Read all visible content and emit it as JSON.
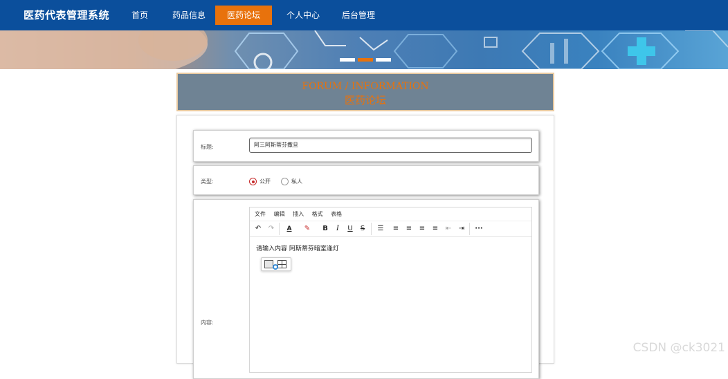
{
  "nav": {
    "brand": "医药代表管理系统",
    "items": [
      "首页",
      "药品信息",
      "医药论坛",
      "个人中心",
      "后台管理"
    ],
    "active_index": 2
  },
  "colors": {
    "nav_bg": "#0b4f9c",
    "accent": "#e8720c",
    "title_bg": "#6f8394"
  },
  "banner": {
    "slides": 3,
    "active_slide": 1
  },
  "section_title": {
    "en": "FORUM / INFORMATION",
    "cn": "医药论坛"
  },
  "form": {
    "title_label": "标题:",
    "title_value": "阿三阿斯蒂芬撒旦",
    "type_label": "类型:",
    "type_options": [
      "公开",
      "私人"
    ],
    "type_selected": "公开",
    "content_label": "内容:"
  },
  "editor": {
    "menus": [
      "文件",
      "编辑",
      "插入",
      "格式",
      "表格"
    ],
    "toolbar_icons": [
      "undo-icon",
      "redo-icon",
      "text-color-icon",
      "highlight-icon",
      "bold-icon",
      "italic-icon",
      "underline-icon",
      "strikethrough-icon",
      "list-icon",
      "align-left-icon",
      "align-center-icon",
      "align-right-icon",
      "align-justify-icon",
      "outdent-icon",
      "indent-icon",
      "more-icon"
    ],
    "bold_glyph": "B",
    "italic_glyph": "I",
    "underline_glyph": "U",
    "strike_glyph": "S",
    "text_color_glyph": "A",
    "more_glyph": "···",
    "content": "请输入内容 阿斯蒂芬暗室逢灯",
    "popup_icons": [
      "image-icon",
      "table-icon"
    ]
  },
  "watermark": "CSDN @ck3021"
}
